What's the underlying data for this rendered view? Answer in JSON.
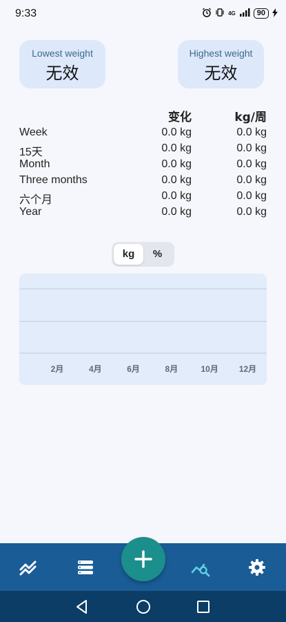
{
  "status_bar": {
    "time": "9:33",
    "network": "4G",
    "battery": "90"
  },
  "cards": {
    "lowest": {
      "title": "Lowest weight",
      "value": "无效"
    },
    "highest": {
      "title": "Highest weight",
      "value": "无效"
    }
  },
  "stats": {
    "headers": {
      "label": "",
      "change": "变化",
      "rate": "kg/周"
    },
    "rows": [
      {
        "label": "Week",
        "change": "0.0 kg",
        "rate": "0.0 kg"
      },
      {
        "label": "15天",
        "change": "0.0 kg",
        "rate": "0.0 kg"
      },
      {
        "label": "Month",
        "change": "0.0 kg",
        "rate": "0.0 kg"
      },
      {
        "label": "Three months",
        "change": "0.0 kg",
        "rate": "0.0 kg"
      },
      {
        "label": "六个月",
        "change": "0.0 kg",
        "rate": "0.0 kg"
      },
      {
        "label": "Year",
        "change": "0.0 kg",
        "rate": "0.0 kg"
      }
    ]
  },
  "unit_toggle": {
    "options": [
      "kg",
      "%"
    ],
    "selected": "kg"
  },
  "chart_data": {
    "type": "line",
    "title": "",
    "xlabel": "",
    "ylabel": "",
    "categories": [
      "2月",
      "4月",
      "6月",
      "8月",
      "10月",
      "12月"
    ],
    "series": [],
    "grid": true
  },
  "bottom_nav": {
    "items": [
      "trend",
      "list",
      "add",
      "analysis",
      "settings"
    ],
    "active": "analysis",
    "colors": {
      "bar": "#1a5c96",
      "active": "#5fd0e0",
      "icon": "#ffffff",
      "fab": "#1b8f8c"
    }
  },
  "system_nav": {
    "items": [
      "back",
      "home",
      "recents"
    ]
  }
}
